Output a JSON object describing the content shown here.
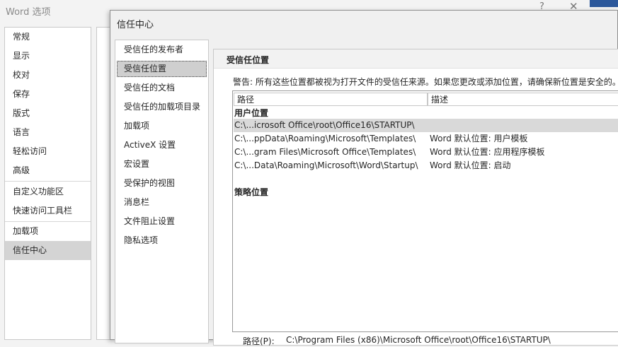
{
  "outer": {
    "title": "Word 选项",
    "help_glyph": "?",
    "close_glyph": "✕",
    "nav_items": [
      "常规",
      "显示",
      "校对",
      "保存",
      "版式",
      "语言",
      "轻松访问",
      "高级",
      "自定义功能区",
      "快速访问工具栏",
      "加载项",
      "信任中心"
    ],
    "selected_nav": "信任中心"
  },
  "dialog": {
    "title": "信任中心",
    "nav_items": [
      "受信任的发布者",
      "受信任位置",
      "受信任的文档",
      "受信任的加载项目录",
      "加载项",
      "ActiveX 设置",
      "宏设置",
      "受保护的视图",
      "消息栏",
      "文件阻止设置",
      "隐私选项"
    ],
    "selected_nav": "受信任位置"
  },
  "content": {
    "section_title": "受信任位置",
    "warning": "警告: 所有这些位置都被视为打开文件的受信任来源。如果您更改或添加位置，请确保新位置是安全的。",
    "table": {
      "columns": [
        "路径",
        "描述"
      ],
      "user_group_label": "用户位置",
      "rows": [
        {
          "path": "C:\\...icrosoft Office\\root\\Office16\\STARTUP\\",
          "desc": ""
        },
        {
          "path": "C:\\...ppData\\Roaming\\Microsoft\\Templates\\",
          "desc": "Word 默认位置: 用户模板"
        },
        {
          "path": "C:\\...gram Files\\Microsoft Office\\Templates\\",
          "desc": "Word 默认位置: 应用程序模板"
        },
        {
          "path": "C:\\...Data\\Roaming\\Microsoft\\Word\\Startup\\",
          "desc": "Word 默认位置: 启动"
        }
      ],
      "policy_group_label": "策略位置"
    },
    "path_label": "路径(P):",
    "path_value": "C:\\Program Files (x86)\\Microsoft Office\\root\\Office16\\STARTUP\\"
  },
  "colors": {
    "accent": "#2b579a",
    "selection": "#d9d9d9"
  }
}
